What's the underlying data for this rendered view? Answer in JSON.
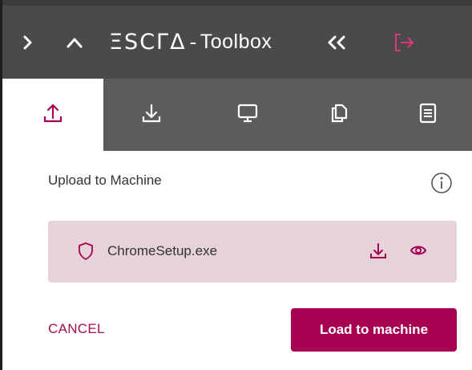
{
  "header": {
    "logo": "ΞSCΓΔ",
    "separator": "-",
    "title": "Toolbox",
    "icons": [
      "chevron-right-icon",
      "chevron-up-icon",
      "double-chevron-left-icon",
      "logout-icon"
    ]
  },
  "tabs": [
    {
      "icon": "upload-icon",
      "active": true
    },
    {
      "icon": "download-icon",
      "active": false
    },
    {
      "icon": "monitor-icon",
      "active": false
    },
    {
      "icon": "copy-icon",
      "active": false
    },
    {
      "icon": "document-list-icon",
      "active": false
    }
  ],
  "upload": {
    "section_title": "Upload to Machine",
    "file": {
      "name": "ChromeSetup.exe"
    },
    "cancel_label": "CANCEL",
    "load_label": "Load to machine"
  },
  "colors": {
    "accent": "#a80050",
    "header_bg": "#4a4a4a",
    "tabs_bg": "#5c5c5c",
    "file_bg": "#e5d3d9",
    "logout_pink": "#e0337f"
  }
}
